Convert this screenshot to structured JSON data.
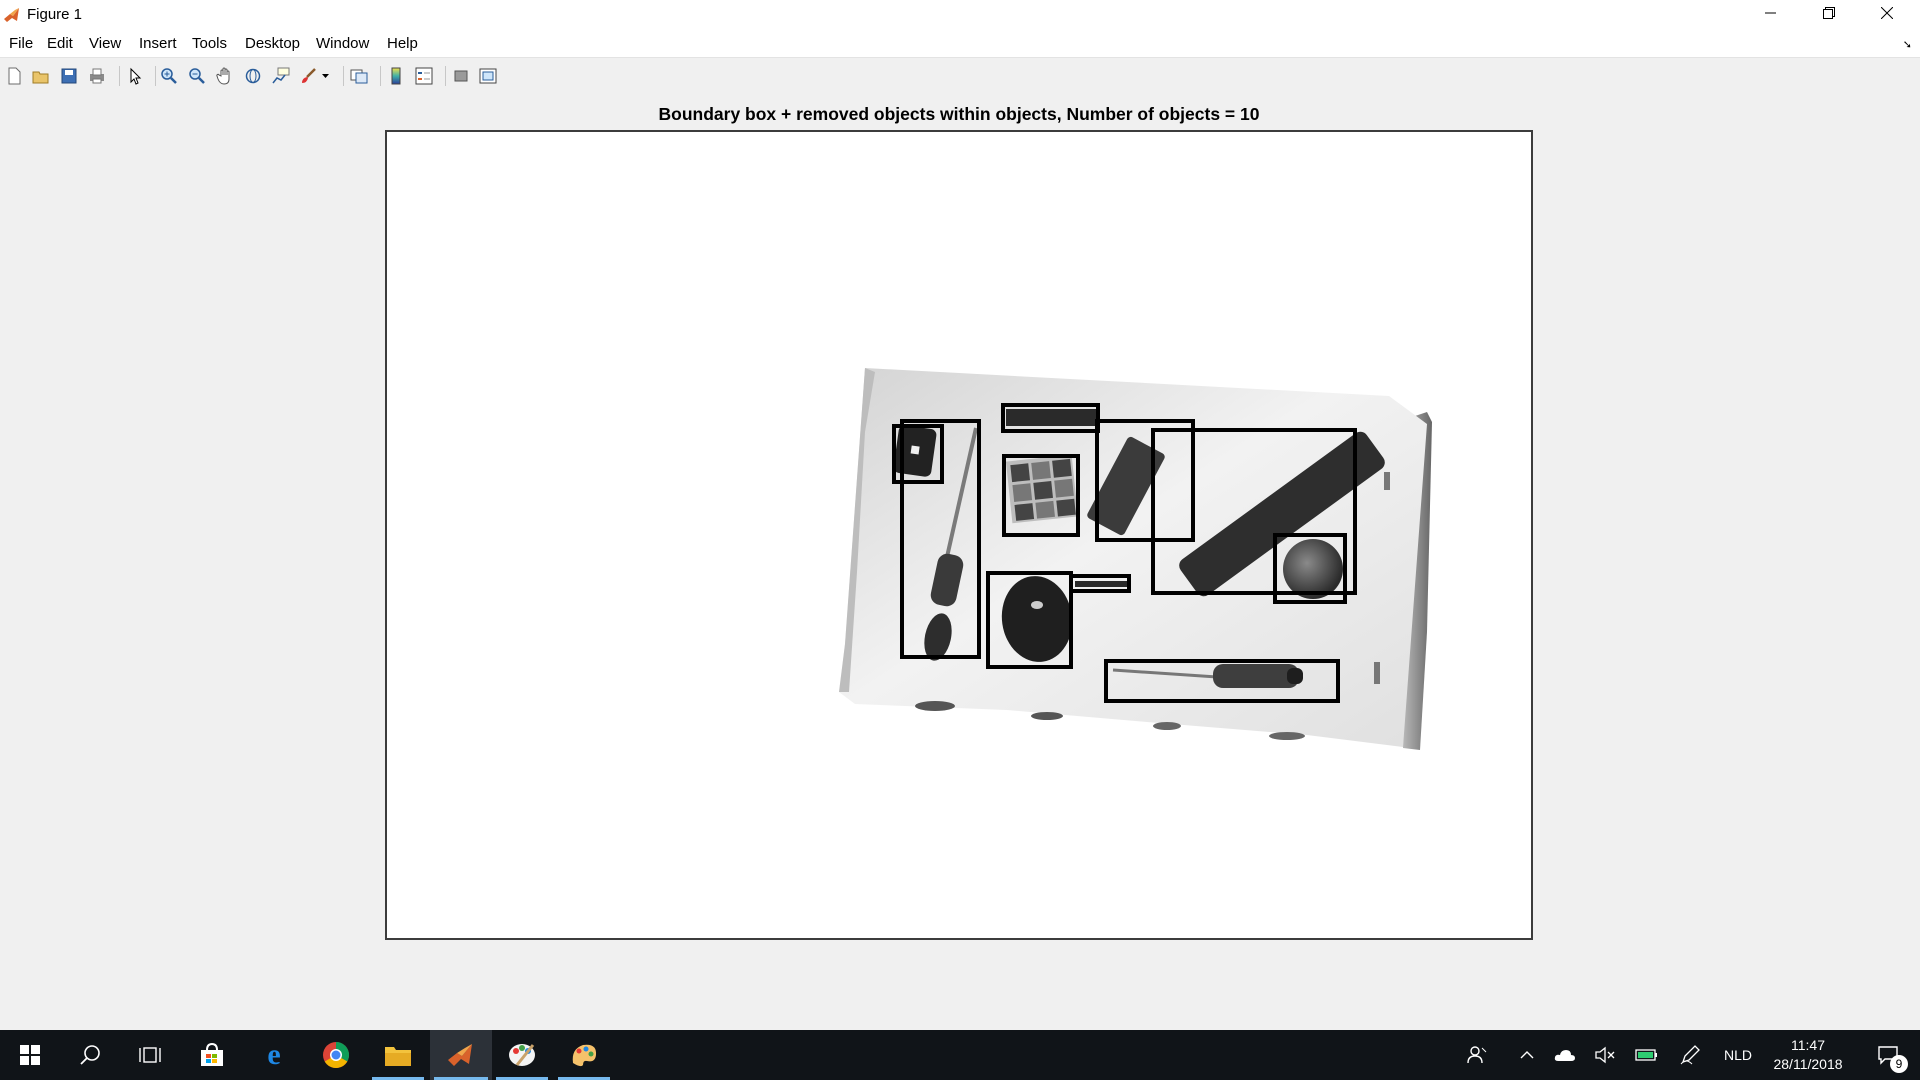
{
  "window": {
    "title": "Figure 1",
    "minimize_icon": "minimize-icon",
    "restore_icon": "restore-icon",
    "close_icon": "close-icon"
  },
  "menu": {
    "items": [
      "File",
      "Edit",
      "View",
      "Insert",
      "Tools",
      "Desktop",
      "Window",
      "Help"
    ]
  },
  "toolbar": {
    "buttons": [
      "new-figure-icon",
      "open-file-icon",
      "save-icon",
      "print-icon",
      "pointer-icon",
      "zoom-in-icon",
      "zoom-out-icon",
      "pan-hand-icon",
      "rotate-3d-icon",
      "data-cursor-icon",
      "brush-icon",
      "brush-dropdown-icon",
      "link-plot-icon",
      "colorbar-icon",
      "legend-icon",
      "hide-plot-tools-icon",
      "show-plot-tools-icon"
    ]
  },
  "figure": {
    "title": "Boundary box + removed objects within objects, Number of objects = 10",
    "bounding_box_count": 10
  },
  "taskbar": {
    "apps": [
      "start-icon",
      "search-icon",
      "task-view-icon",
      "store-icon",
      "edge-icon",
      "chrome-icon",
      "file-explorer-icon",
      "matlab-icon",
      "paint-app-icon",
      "paint-3d-icon"
    ],
    "language": "NLD",
    "time": "11:47",
    "date": "28/11/2018",
    "notification_count": "9"
  },
  "colors": {
    "taskbar_bg": "#101418",
    "active_indicator": "#76b9ed",
    "figure_bg": "#f0f0f0",
    "axes_bg": "#ffffff"
  }
}
